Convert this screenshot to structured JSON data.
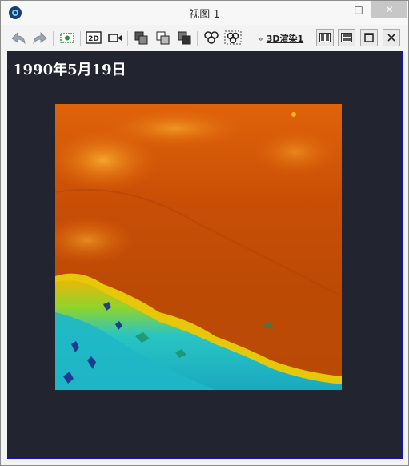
{
  "window": {
    "title": "视图 1",
    "minimize_glyph": "–",
    "maximize_glyph": "□",
    "close_glyph": "✕"
  },
  "toolbar": {
    "tools": [
      {
        "id": "back",
        "icon": "undo-arrow-icon"
      },
      {
        "id": "forward",
        "icon": "redo-arrow-icon"
      },
      {
        "id": "snapshot",
        "icon": "camera-snapshot-icon"
      },
      {
        "id": "mode-2d",
        "icon": "2d-mode-icon",
        "label": "2D"
      },
      {
        "id": "video",
        "icon": "video-camera-icon"
      },
      {
        "id": "layer-a",
        "icon": "layers-icon"
      },
      {
        "id": "layer-b",
        "icon": "layers-outline-icon"
      },
      {
        "id": "layer-c",
        "icon": "layers-stack-icon"
      },
      {
        "id": "link",
        "icon": "link-icon"
      },
      {
        "id": "select",
        "icon": "selection-icon"
      }
    ],
    "overflow_glyph": "»",
    "render_label": "3D渲染1",
    "view_buttons": [
      "split-vertical-icon",
      "split-horizontal-icon",
      "maximize-view-icon",
      "close-view-icon"
    ]
  },
  "viewport": {
    "date_label": "1990年5月19日",
    "background": "#222430",
    "border_color": "#1010c0"
  }
}
